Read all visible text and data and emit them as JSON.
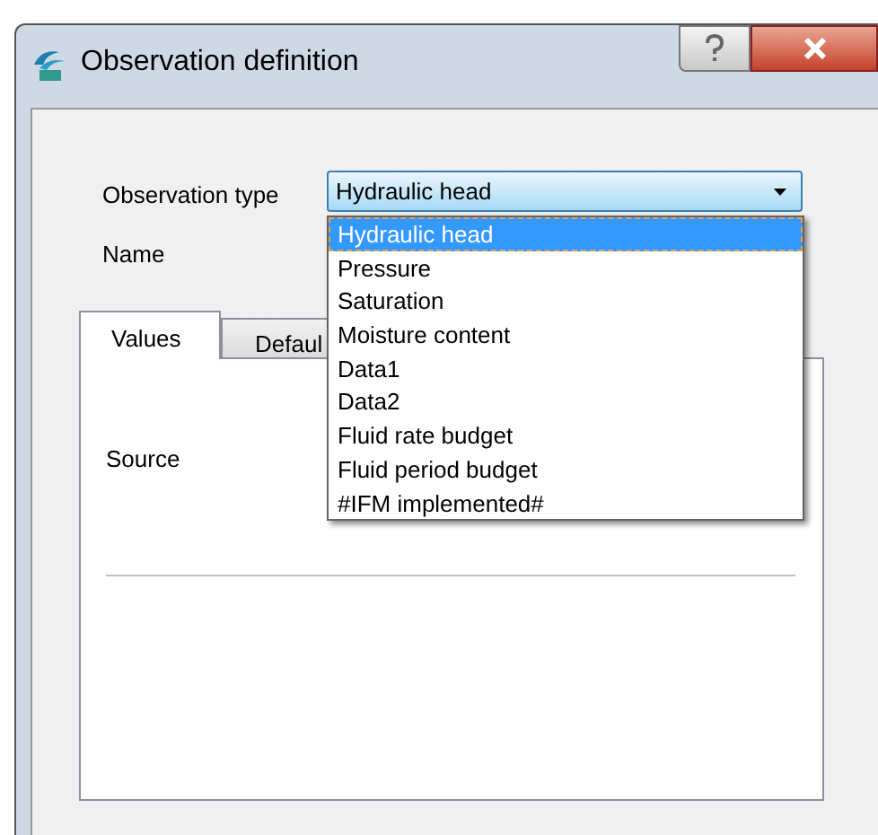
{
  "window": {
    "title": "Observation definition"
  },
  "fields": [
    {
      "label": "Observation type",
      "value": "Hydraulic head",
      "expanded": true
    },
    {
      "label": "Name"
    }
  ],
  "dropdown": {
    "options": [
      {
        "label": "Hydraulic head",
        "selected": true
      },
      {
        "label": "Pressure",
        "selected": false
      },
      {
        "label": "Saturation",
        "selected": false
      },
      {
        "label": "Moisture content",
        "selected": false
      },
      {
        "label": "Data1",
        "selected": false
      },
      {
        "label": "Data2",
        "selected": false
      },
      {
        "label": "Fluid rate budget",
        "selected": false
      },
      {
        "label": "Fluid period budget",
        "selected": false
      },
      {
        "label": "#IFM implemented#",
        "selected": false
      }
    ]
  },
  "tabs": [
    {
      "label": "Values",
      "selected": true
    },
    {
      "label": "Defaul",
      "selected": false
    }
  ],
  "panel": {
    "source_label": "Source"
  }
}
